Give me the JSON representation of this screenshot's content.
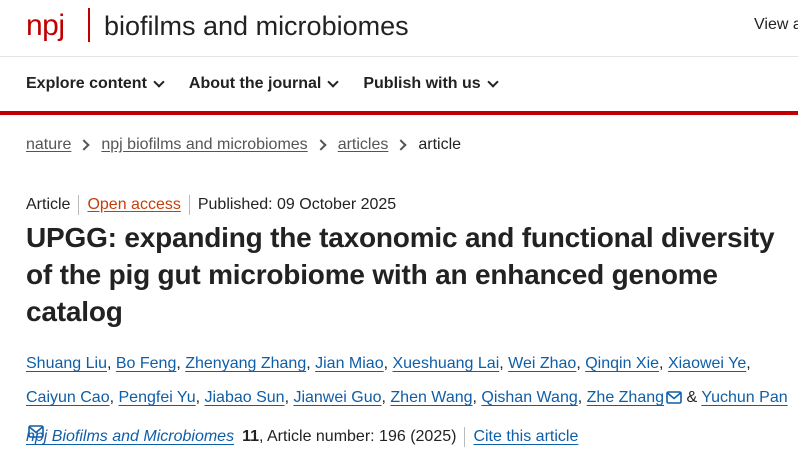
{
  "header": {
    "logo": "npj",
    "journal_name": "biofilms and microbiomes",
    "view_all": "View a"
  },
  "nav": {
    "items": [
      {
        "label": "Explore content"
      },
      {
        "label": "About the journal"
      },
      {
        "label": "Publish with us"
      }
    ]
  },
  "breadcrumb": {
    "items": [
      "nature",
      "npj biofilms and microbiomes",
      "articles"
    ],
    "current": "article"
  },
  "meta": {
    "type": "Article",
    "access": "Open access",
    "published": "Published: 09 October 2025"
  },
  "title": "UPGG: expanding the taxonomic and functional diversity of the pig gut microbiome with an enhanced genome catalog",
  "authors": [
    {
      "name": "Shuang Liu",
      "sep": ", "
    },
    {
      "name": "Bo Feng",
      "sep": ", "
    },
    {
      "name": "Zhenyang Zhang",
      "sep": ", "
    },
    {
      "name": "Jian Miao",
      "sep": ", "
    },
    {
      "name": "Xueshuang Lai",
      "sep": ", "
    },
    {
      "name": "Wei Zhao",
      "sep": ", "
    },
    {
      "name": "Qinqin Xie",
      "sep": ", "
    },
    {
      "name": "Xiaowei Ye",
      "sep": ", "
    },
    {
      "name": "Caiyun Cao",
      "sep": ", "
    },
    {
      "name": "Pengfei Yu",
      "sep": ", "
    },
    {
      "name": "Jiabao Sun",
      "sep": ", "
    },
    {
      "name": "Jianwei Guo",
      "sep": ", "
    },
    {
      "name": "Zhen Wang",
      "sep": ", "
    },
    {
      "name": "Qishan Wang",
      "sep": ", "
    },
    {
      "name": "Zhe Zhang",
      "sep": " & ",
      "email": true
    },
    {
      "name": "Yuchun Pan",
      "sep": "",
      "email": true
    }
  ],
  "citation": {
    "journal": "npj Biofilms and Microbiomes",
    "volume": "11",
    "info": ", Article number: 196 (2025)",
    "cite_link": "Cite this article"
  },
  "colors": {
    "brand_red": "#c00000",
    "link_blue": "#0f5ea8",
    "open_access_orange": "#c4400b"
  }
}
